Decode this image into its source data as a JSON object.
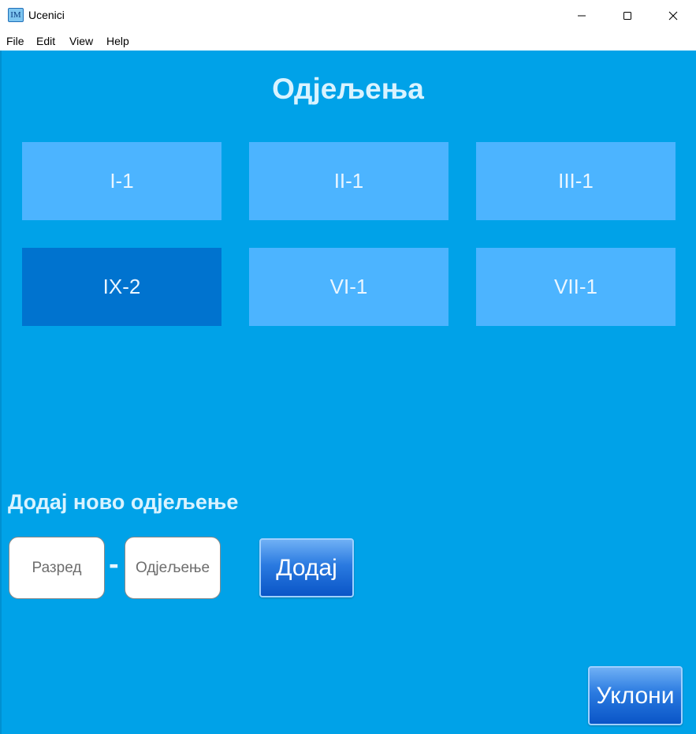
{
  "window": {
    "title": "Ucenici",
    "icon_label": "IM",
    "background": "#00a2e8"
  },
  "menu": [
    "File",
    "Edit",
    "View",
    "Help"
  ],
  "page_title": "Одјељења",
  "classes": [
    {
      "label": "I-1",
      "selected": false
    },
    {
      "label": "II-1",
      "selected": false
    },
    {
      "label": "III-1",
      "selected": false
    },
    {
      "label": "IX-2",
      "selected": true
    },
    {
      "label": "VI-1",
      "selected": false
    },
    {
      "label": "VII-1",
      "selected": false
    }
  ],
  "add_section": {
    "title": "Додај ново одјељење",
    "grade_placeholder": "Разред",
    "grade_value": "",
    "separator": "-",
    "section_placeholder": "Одјељење",
    "section_value": "",
    "add_button": "Додај"
  },
  "remove_button": "Уклони",
  "colors": {
    "tile": "#4cb4ff",
    "tile_selected": "#0073cf",
    "heading": "#d9f3ff"
  }
}
